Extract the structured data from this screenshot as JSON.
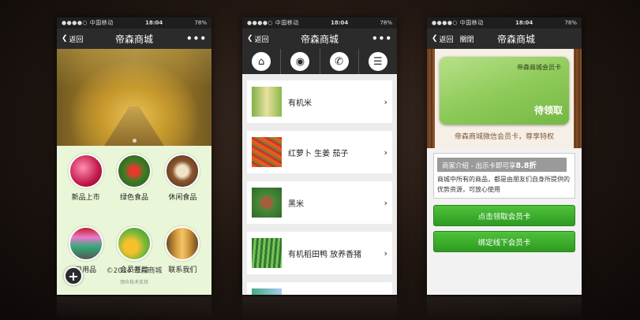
{
  "status": {
    "carrier": "●●●●○ 中国移动",
    "time": "18:04",
    "battery": "78%"
  },
  "screen1": {
    "back": "返回",
    "title": "帝森商城",
    "more": "•••",
    "grid": [
      {
        "label": "新品上市"
      },
      {
        "label": "绿色食品"
      },
      {
        "label": "休闲食品"
      },
      {
        "label": "日用品"
      },
      {
        "label": "会员互动"
      },
      {
        "label": "联系我们"
      }
    ],
    "copyright": "©2014 帝森商城",
    "support": "领众技术支持"
  },
  "screen2": {
    "back": "返回",
    "title": "帝森商城",
    "more": "•••",
    "tabs": [
      "home-icon",
      "location-icon",
      "phone-icon",
      "list-icon"
    ],
    "products": [
      {
        "name": "有机米"
      },
      {
        "name": "红萝卜 生姜 茄子"
      },
      {
        "name": "黑米"
      },
      {
        "name": "有机稻田鸭 放养香猪"
      }
    ]
  },
  "screen3": {
    "back": "返回",
    "close": "關閉",
    "title": "帝森商城",
    "card_name": "帝森商城会员卡",
    "card_status": "待领取",
    "tagline": "帝森商城微信会员卡，尊享特权",
    "info_title": "商家介绍 - 出示卡即可享",
    "info_discount": "8.8折",
    "info_body": "商城中所有的商品，都是由朋友们自身所提供的优势资源，可放心使用",
    "btn_claim": "点击领取会员卡",
    "btn_bind": "绑定线下会员卡"
  }
}
